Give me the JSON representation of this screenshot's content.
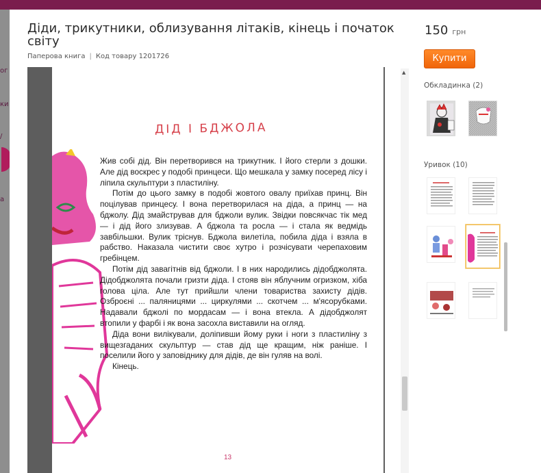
{
  "product": {
    "title": "Діди, трикутники, облизування літаків, кінець і початок світу",
    "format": "Паперова книга",
    "code_label": "Код товару 1201726"
  },
  "price": {
    "value": "150",
    "currency": "грн"
  },
  "buy_button": {
    "label": "Купити"
  },
  "covers": {
    "label": "Обкладинка (2)"
  },
  "excerpt": {
    "label": "Уривок (10)"
  },
  "book_page": {
    "heading": "ДІД І БДЖОЛА",
    "paragraphs": [
      "Жив собі дід. Він перетворився на трикутник. І його стерли з дошки. Але дід воскрес у подобі принцеси. Що мешкала у замку посеред лісу і ліпила скульптури з пластиліну.",
      "Потім до цього замку в подобі жовтого овалу приїхав принц. Він поцілував принцесу. І вона перетворилася на діда, а принц — на бджолу. Дід змайстрував для бджоли вулик. Звідки повсякчас тік мед — і дід його злизував. А бджола та росла — і стала як ведмідь завбільшки. Вулик тріснув. Бджола вилетіла, побила діда і взяла в рабство. Наказала чистити своє хутро і розчісувати черепаховим гребінцем.",
      "Потім дід завагітнів від бджоли. І в них народились дідобджолята. Дідобджолята почали гризти діда. І стояв він яблучним огризком, хіба голова ціла. Але тут прийшли члени товариства захисту дідів. Озброєні ... паляницями ... циркулями ... скотчем ... м'ясорубками. Надавали бджолі по мордасам — і вона втекла. А дідобджолят втопили у фарбі і як вона засохла виставили на огляд.",
      "Діда вони вилікували, доліпивши йому руки і ноги з пластиліну з вищезгаданих скульптур — став дід ще кращим, ніж раніше. І поселили його у заповіднику для дідів, де він гуляв на волі.",
      "Кінець."
    ],
    "page_number": "13"
  },
  "backdrop": {
    "left_fragments": [
      "ог",
      "ки",
      "/",
      "а"
    ]
  },
  "colors": {
    "accent": "#f0650a",
    "brand_bar": "#7a1d4d",
    "heading_red": "#d6404a",
    "drawing_pink": "#e0379a"
  },
  "icons": [
    "scroll-up-arrow-icon",
    "character-drawing"
  ]
}
